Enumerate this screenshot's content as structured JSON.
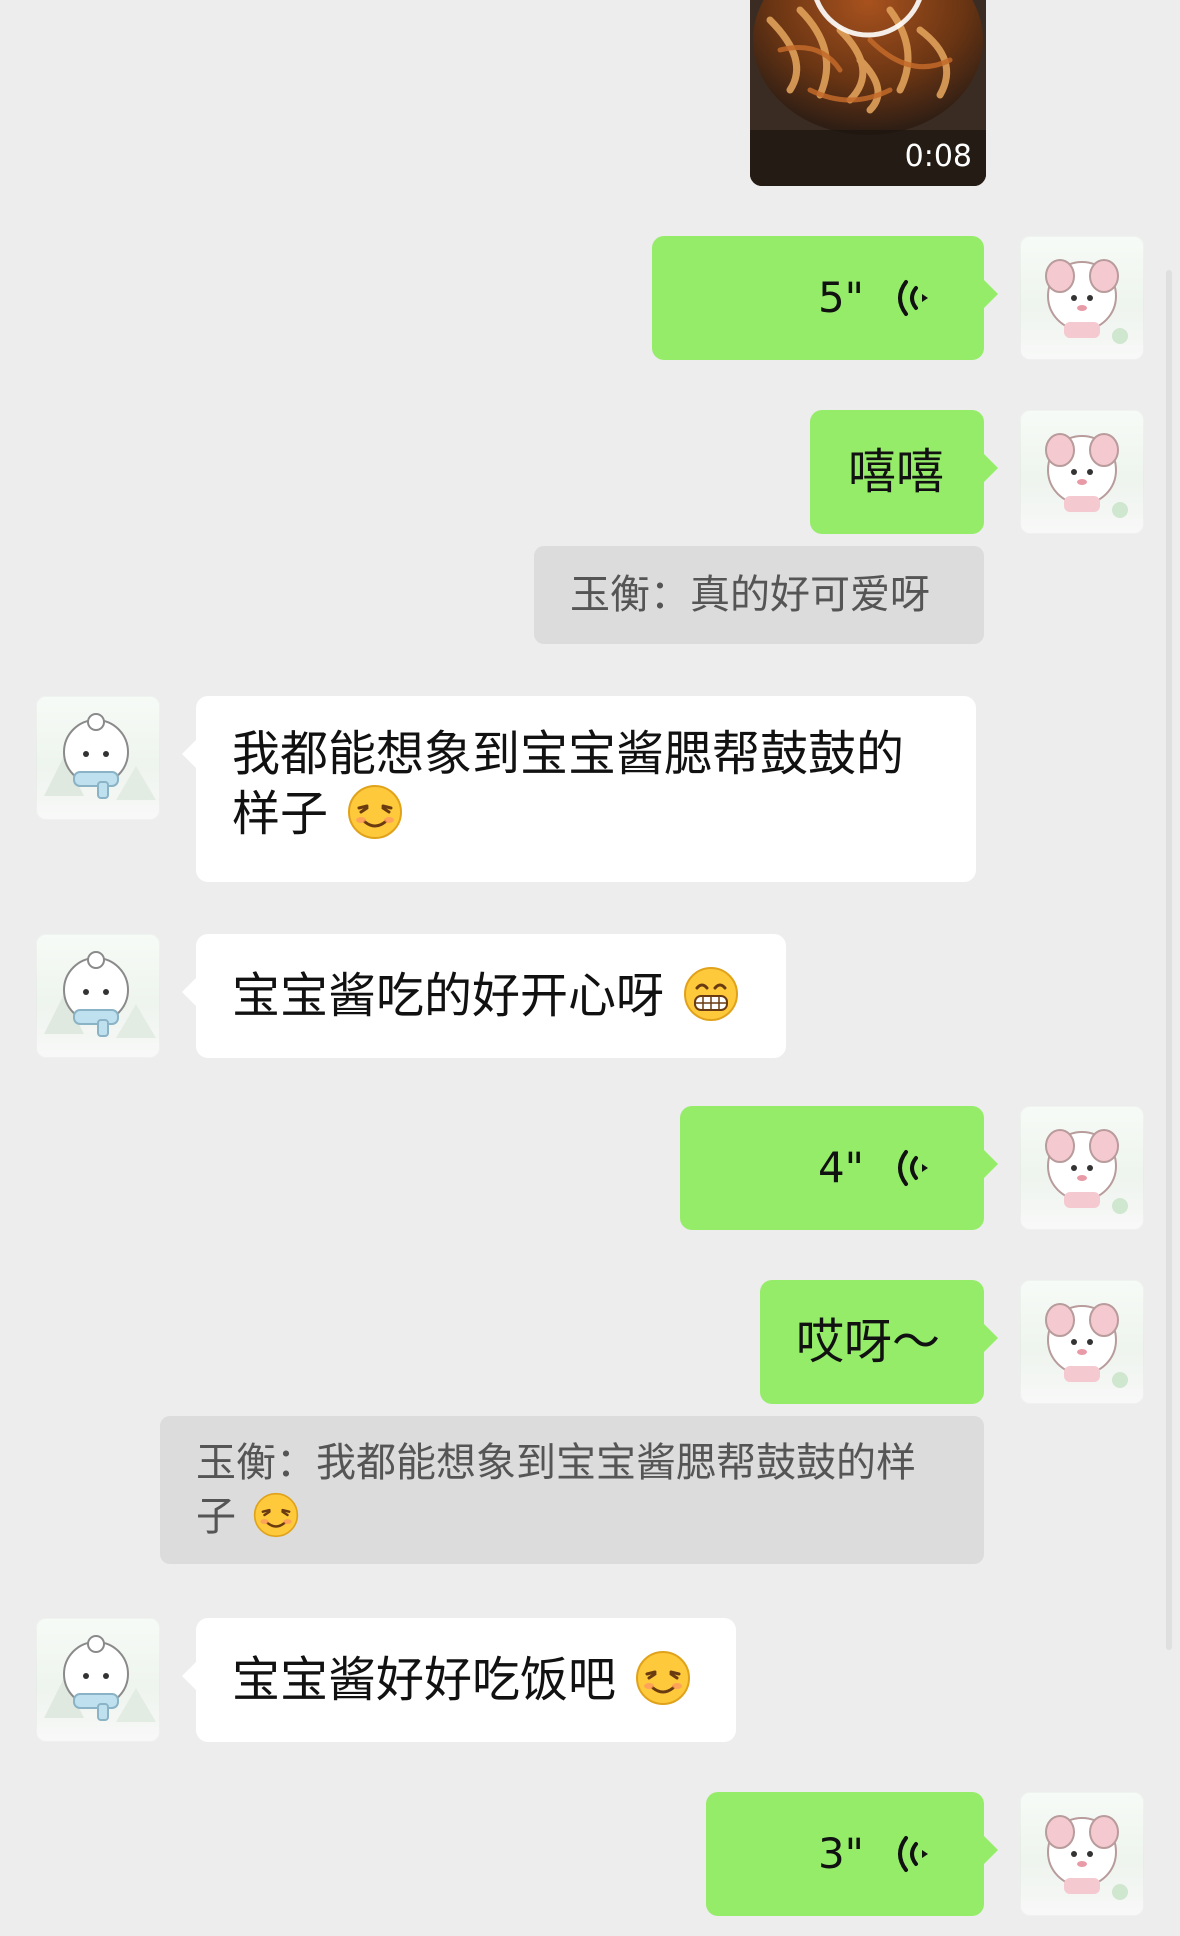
{
  "video": {
    "duration": "0:08"
  },
  "messages": {
    "m1_voice": {
      "duration": "5\""
    },
    "m2_text": {
      "text": "嘻嘻"
    },
    "m2_quote": {
      "text": "玉衡：真的好可爱呀"
    },
    "m3_text": {
      "line1": "我都能想象到宝宝酱腮帮鼓鼓的",
      "line2": "样子",
      "emoji": "relieved-face-emoji"
    },
    "m4_text": {
      "text": "宝宝酱吃的好开心呀",
      "emoji": "grinning-face-emoji"
    },
    "m5_voice": {
      "duration": "4\""
    },
    "m6_text": {
      "text": "哎呀～"
    },
    "m6_quote": {
      "line1": "玉衡：我都能想象到宝宝酱腮帮鼓鼓的样",
      "line2": "子",
      "emoji": "relieved-face-emoji"
    },
    "m7_text": {
      "text": "宝宝酱好好吃饭吧",
      "emoji": "relieved-face-emoji"
    },
    "m8_voice": {
      "duration": "3\""
    }
  },
  "icons": {
    "voice": "voice-wave-icon",
    "avatar_self": "pink-bunny-avatar",
    "avatar_other": "white-puppy-avatar"
  },
  "colors": {
    "background": "#ededed",
    "bubble_out": "#95ec69",
    "bubble_in": "#ffffff",
    "quote_bg": "#dcdcdc"
  }
}
